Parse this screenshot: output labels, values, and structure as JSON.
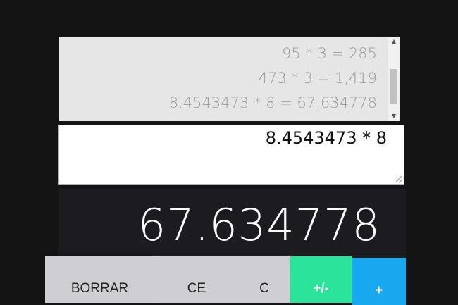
{
  "history": [
    "95 * 3 = 285",
    "473 * 3 = 1,419",
    "8.4543473 * 8 = 67.634778"
  ],
  "input": {
    "expression": "8.4543473 * 8"
  },
  "display": {
    "result": "67.634778"
  },
  "buttons": {
    "borrar": "BORRAR",
    "ce": "CE",
    "c": "C",
    "plus_minus": "+/-",
    "plus": "+"
  },
  "colors": {
    "background": "#141414",
    "history_bg": "#e6e6e6",
    "display_bg": "#1c1b20",
    "gray_button": "#cfced3",
    "green_button": "#2be39a",
    "blue_button": "#17a8f0",
    "input_border": "#8bb3e9"
  },
  "icons": {
    "scroll_up": "triangle-up",
    "scroll_down": "triangle-down"
  }
}
